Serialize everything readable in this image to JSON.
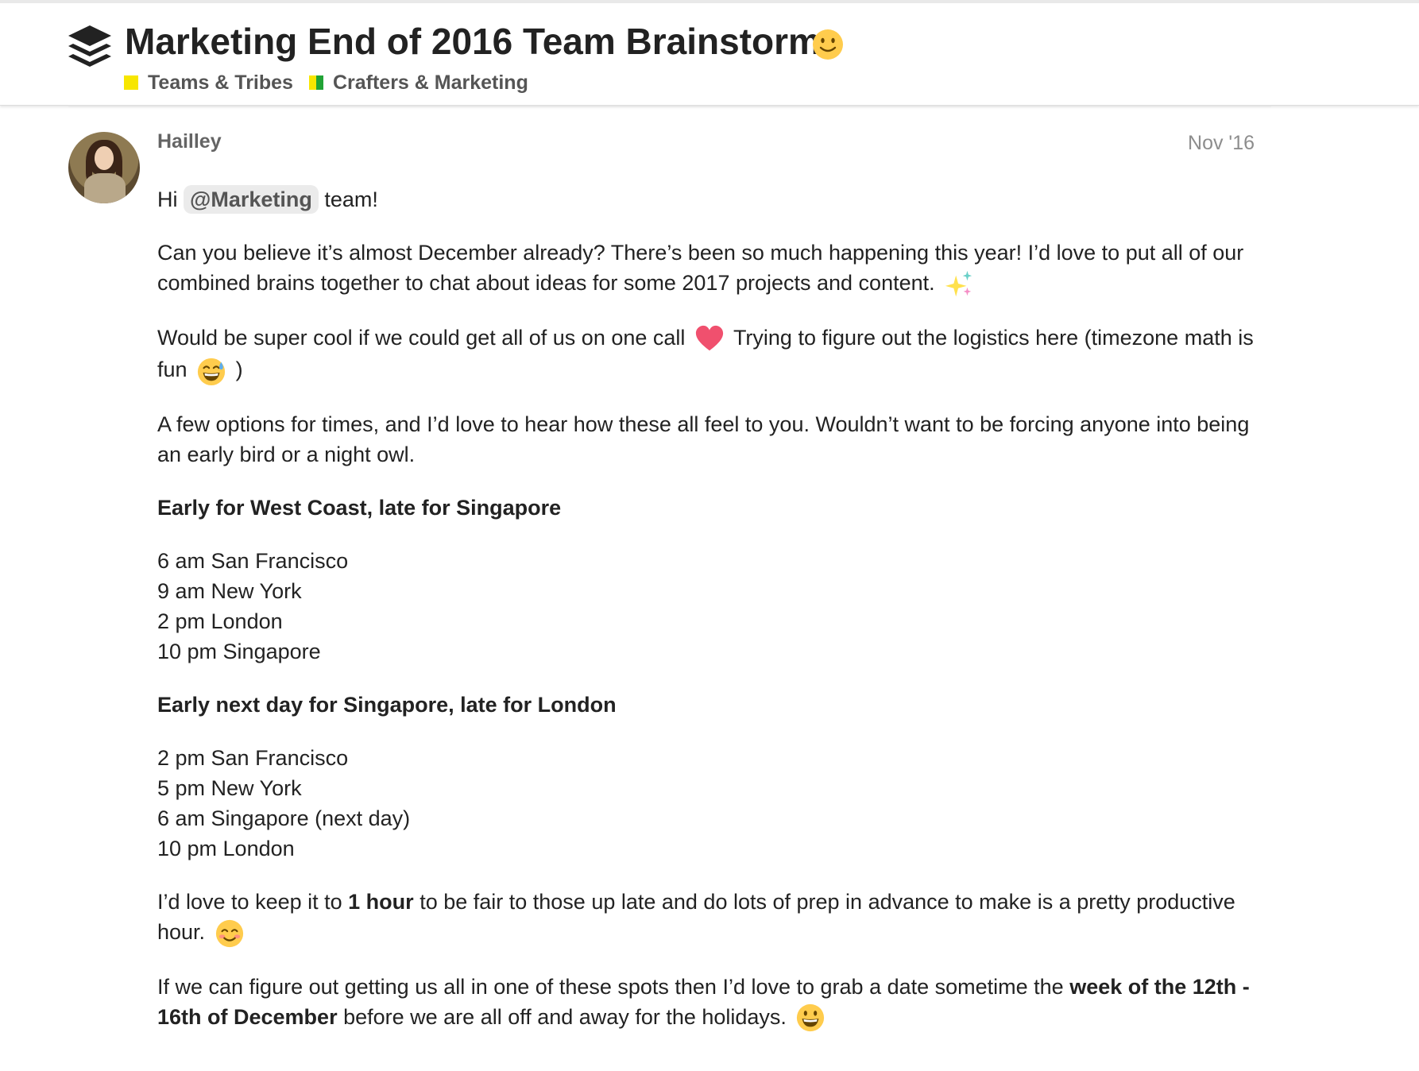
{
  "topic": {
    "title": "Marketing End of 2016 Team Brainstorm",
    "categories": [
      {
        "label": "Teams & Tribes",
        "color": "#f7e600"
      },
      {
        "label": "Crafters & Marketing",
        "colors": [
          "#f7e600",
          "#21a336"
        ]
      }
    ]
  },
  "post": {
    "username": "Hailley",
    "date": "Nov '16",
    "greeting": {
      "hi": "Hi",
      "mention": "@Marketing",
      "rest": "team!"
    },
    "p1": "Can you believe it’s almost December already? There’s been so much happening this year! I’d love to put all of our combined brains together to chat about ideas for some 2017 projects and content.",
    "p2a": "Would be super cool if we could get all of us on one call",
    "p2b": "Trying to figure out the logistics here (timezone math is fun",
    "p2c": ")",
    "p3": "A few options for times, and I’d love to hear how these all feel to you. Wouldn’t want to be forcing anyone into being an early bird or a night owl.",
    "option1": {
      "heading": "Early for West Coast, late for Singapore",
      "times": [
        "6 am San Francisco",
        "9 am New York",
        "2 pm London",
        "10 pm Singapore"
      ]
    },
    "option2": {
      "heading": "Early next day for Singapore, late for London",
      "times": [
        "2 pm San Francisco",
        "5 pm New York",
        "6 am Singapore (next day)",
        "10 pm London"
      ]
    },
    "p4": {
      "before": "I’d love to keep it to",
      "bold": "1 hour",
      "after": "to be fair to those up late and do lots of prep in advance to make is a pretty productive hour."
    },
    "p5": {
      "before": "If we can figure out getting us all in one of these spots then I’d love to grab a date sometime the",
      "bold": "week of the 12th - 16th of December",
      "after": "before we are all off and away for the holidays."
    },
    "emojis": [
      "slightly-smiling-face-icon",
      "sparkles-icon",
      "heart-icon",
      "sweat-smile-icon",
      "blush-icon",
      "grinning-face-icon"
    ]
  }
}
